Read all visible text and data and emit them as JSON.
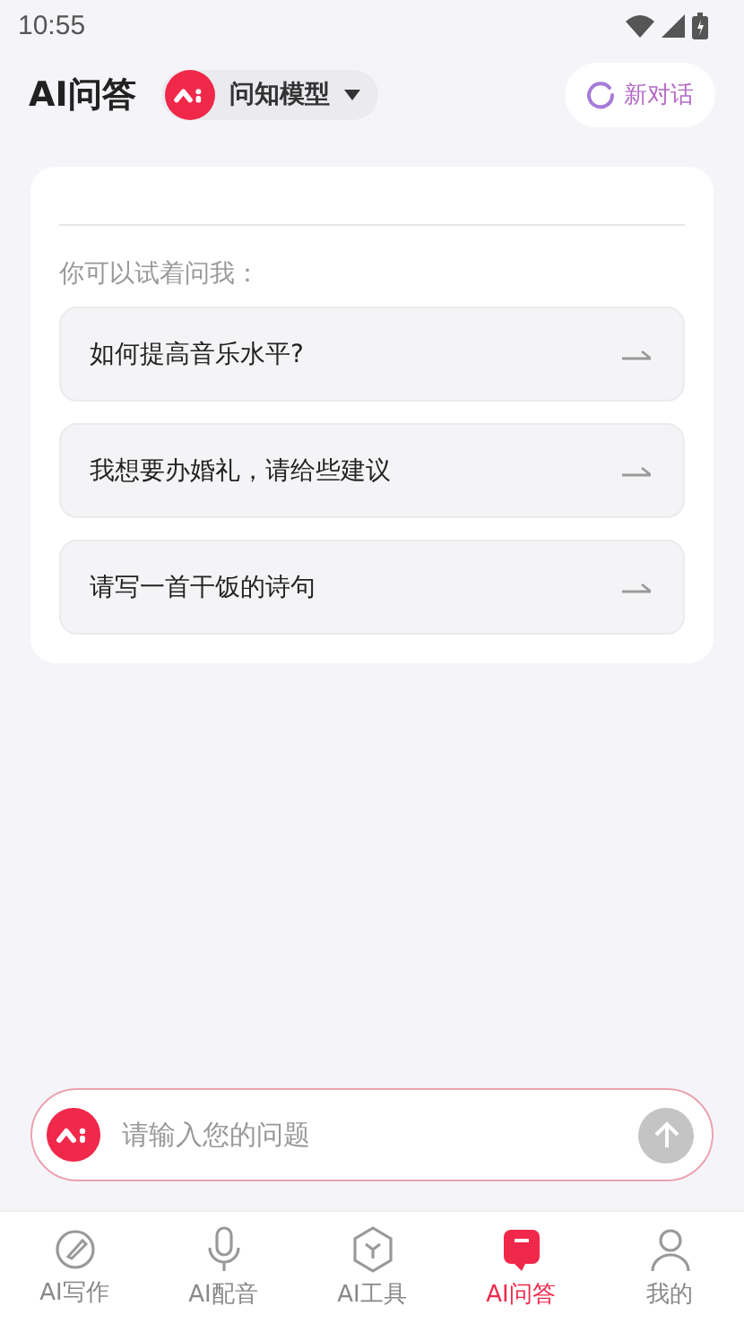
{
  "status_bar": {
    "time": "10:55"
  },
  "header": {
    "title": "AI问答",
    "model": "问知模型",
    "new_chat": "新对话"
  },
  "card": {
    "prompt": "你可以试着问我：",
    "suggestions": [
      {
        "text": "如何提高音乐水平?"
      },
      {
        "text": "我想要办婚礼，请给些建议"
      },
      {
        "text": "请写一首干饭的诗句"
      }
    ]
  },
  "input": {
    "placeholder": "请输入您的问题"
  },
  "tabs": [
    {
      "label": "AI写作",
      "kind": "pen",
      "selected": false
    },
    {
      "label": "AI配音",
      "kind": "mic",
      "selected": false
    },
    {
      "label": "AI工具",
      "kind": "cube",
      "selected": false
    },
    {
      "label": "AI问答",
      "kind": "chat",
      "selected": true
    },
    {
      "label": "我的",
      "kind": "user",
      "selected": false
    }
  ]
}
